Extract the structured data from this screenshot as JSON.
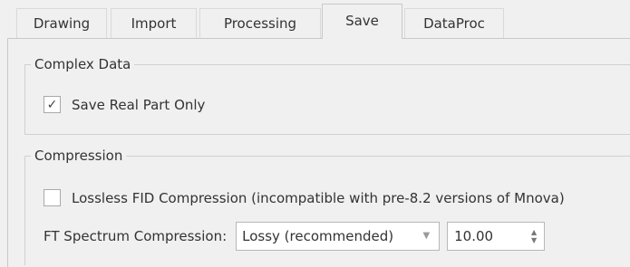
{
  "tabs": [
    {
      "label": "Drawing",
      "active": false
    },
    {
      "label": "Import",
      "active": false
    },
    {
      "label": "Processing",
      "active": false
    },
    {
      "label": "Save",
      "active": true
    },
    {
      "label": "DataProc",
      "active": false
    }
  ],
  "complex_data": {
    "title": "Complex Data",
    "save_real_part_only": {
      "label": "Save Real Part Only",
      "checked": true
    }
  },
  "compression": {
    "title": "Compression",
    "lossless_fid": {
      "label": "Lossless FID Compression (incompatible with pre-8.2 versions of Mnova)",
      "checked": false
    },
    "ft_spectrum_label": "FT Spectrum Compression:",
    "ft_spectrum_value": "Lossy (recommended)",
    "ft_spectrum_level": "10.00"
  },
  "icons": {
    "check": "check-icon",
    "dropdown": "chevron-down-icon",
    "spin": "spin-arrows-icon"
  }
}
